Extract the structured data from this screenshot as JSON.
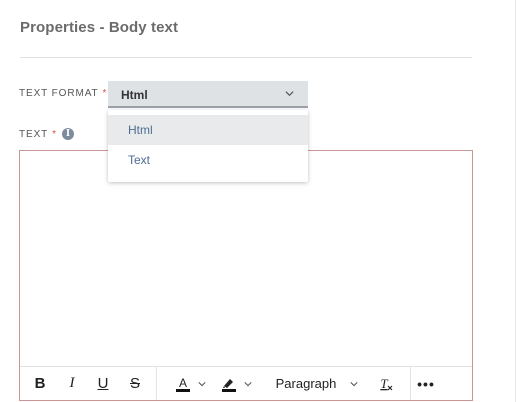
{
  "panel": {
    "title": "Properties - Body text"
  },
  "text_format": {
    "label": "TEXT FORMAT",
    "required_mark": "*",
    "selected": "Html",
    "options": [
      {
        "label": "Html",
        "highlighted": true
      },
      {
        "label": "Text",
        "highlighted": false
      }
    ]
  },
  "text_field": {
    "label": "TEXT",
    "required_mark": "*",
    "info_icon": "info-icon",
    "info_glyph": "i",
    "value": ""
  },
  "toolbar": {
    "bold": "B",
    "italic": "I",
    "underline": "U",
    "strikethrough": "S",
    "font_color": "A",
    "paragraph": "Paragraph",
    "clear_format": "T",
    "more": "•••"
  },
  "colors": {
    "editor_border": "#c99595",
    "required": "#d9534f",
    "option_text": "#4d6e94",
    "select_bg": "#dfe2e5"
  }
}
